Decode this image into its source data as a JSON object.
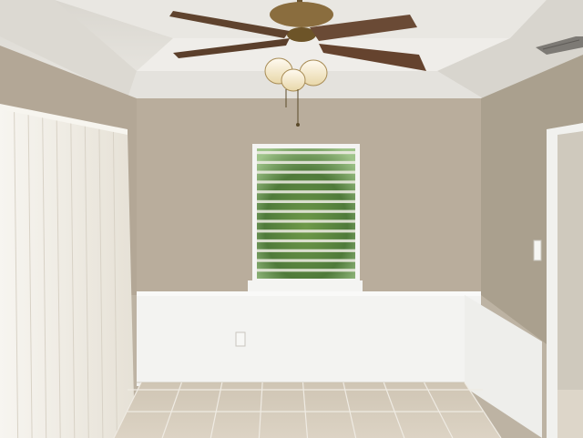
{
  "scene": {
    "kind": "photo",
    "subject": "empty-room-interior",
    "colors": {
      "ceiling": "#e3e1dc",
      "tray_ceiling": "#ecebe7",
      "back_wall": "#b9ad9c",
      "left_wall": "#b3a796",
      "right_wall": "#aaa08e",
      "wainscot": "#f3f3f1",
      "floor_tile": "#d7cdbd",
      "grout": "#efebe3",
      "blinds": "#f0ede6",
      "window_frame": "#f4f4f2",
      "foliage": "#4f7a3a",
      "fan_blade": "#6a4a35",
      "fan_brass": "#8a6d3e",
      "light_glass": "#f3e6c4"
    },
    "fixtures": {
      "fan_blade_count": 4,
      "fan_light_count": 3,
      "window_slat_count": 13,
      "vertical_blind_slat_count": 9
    }
  }
}
